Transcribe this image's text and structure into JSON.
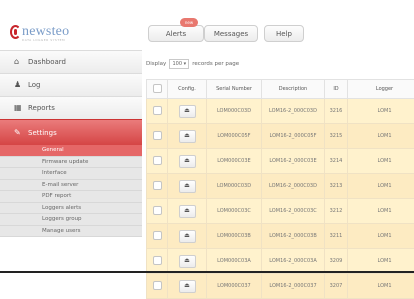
{
  "logo": {
    "text": "newsteo",
    "sub": "DATA LOGGER SYSTEM"
  },
  "nav": [
    {
      "label": "Dashboard",
      "icon": "home-icon"
    },
    {
      "label": "Log",
      "icon": "user-icon"
    },
    {
      "label": "Reports",
      "icon": "chart-icon"
    },
    {
      "label": "Settings",
      "icon": "wrench-icon"
    }
  ],
  "subnav": [
    "General",
    "Firmware update",
    "Interface",
    "E-mail server",
    "PDF report",
    "Loggers alerts",
    "Loggers group",
    "Manage users"
  ],
  "topbar": {
    "alerts": "Alerts",
    "alerts_badge": "new",
    "messages": "Messages",
    "help": "Help"
  },
  "display": {
    "prefix": "Display",
    "value": "100",
    "suffix": "records per page"
  },
  "table": {
    "headers": [
      "",
      "Config.",
      "Serial Number",
      "Description",
      "ID",
      "Logger"
    ],
    "rows": [
      {
        "serial": "LOM000C03D",
        "desc": "LOM16-2_000C03D",
        "id": "3216",
        "logger": "LOM1"
      },
      {
        "serial": "LOM000C05F",
        "desc": "LOM16-2_000C05F",
        "id": "3215",
        "logger": "LOM1"
      },
      {
        "serial": "LOM000C03E",
        "desc": "LOM16-2_000C03E",
        "id": "3214",
        "logger": "LOM1"
      },
      {
        "serial": "LOM000C03D",
        "desc": "LOM16-2_000C03D",
        "id": "3213",
        "logger": "LOM1"
      },
      {
        "serial": "LOM000C03C",
        "desc": "LOM16-2_000C03C",
        "id": "3212",
        "logger": "LOM1"
      },
      {
        "serial": "LOM000C03B",
        "desc": "LOM16-2_000C03B",
        "id": "3211",
        "logger": "LOM1"
      },
      {
        "serial": "LOM000C03A",
        "desc": "LOM16-2_000C03A",
        "id": "3209",
        "logger": "LOM1"
      },
      {
        "serial": "LOM000C037",
        "desc": "LOM16-2_000C037",
        "id": "3207",
        "logger": "LOM1"
      }
    ]
  },
  "colors": {
    "accent": "#d94b4b",
    "row_bg": "#fff2cd"
  }
}
